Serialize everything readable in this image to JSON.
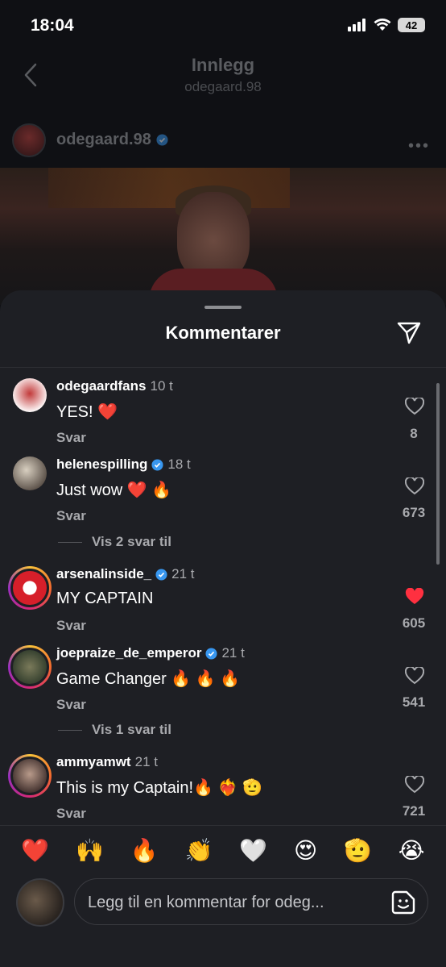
{
  "status_bar": {
    "time": "18:04",
    "battery": "42"
  },
  "post_header": {
    "title": "Innlegg",
    "subtitle": "odegaard.98"
  },
  "post": {
    "username": "odegaard.98"
  },
  "sheet": {
    "title": "Kommentarer"
  },
  "comments": [
    {
      "username": "odegaardfans",
      "time": "10 t",
      "verified": false,
      "text": "YES! ❤️",
      "reply_label": "Svar",
      "likes": "8",
      "liked": false
    },
    {
      "username": "helenespilling",
      "time": "18 t",
      "verified": true,
      "text": "Just wow ❤️ 🔥",
      "reply_label": "Svar",
      "likes": "673",
      "liked": false,
      "more_replies": "Vis 2 svar til"
    },
    {
      "username": "arsenalinside_",
      "time": "21 t",
      "verified": true,
      "text": "MY CAPTAIN",
      "reply_label": "Svar",
      "likes": "605",
      "liked": true
    },
    {
      "username": "joepraize_de_emperor",
      "time": "21 t",
      "verified": true,
      "text": "Game Changer 🔥 🔥 🔥",
      "reply_label": "Svar",
      "likes": "541",
      "liked": false,
      "more_replies": "Vis 1 svar til"
    },
    {
      "username": "ammyamwt",
      "time": "21 t",
      "verified": false,
      "text": "This is my Captain!🔥 ❤️‍🔥 🫡",
      "reply_label": "Svar",
      "likes": "721",
      "liked": false
    }
  ],
  "reactions": [
    "❤️",
    "🙌",
    "🔥",
    "👏",
    "🤍",
    "😍",
    "🫡",
    "😭"
  ],
  "compose": {
    "placeholder": "Legg til en kommentar for odeg..."
  },
  "colors": {
    "background": "#1e1f24",
    "like_red": "#ff3040",
    "verified_blue": "#3897f0"
  }
}
